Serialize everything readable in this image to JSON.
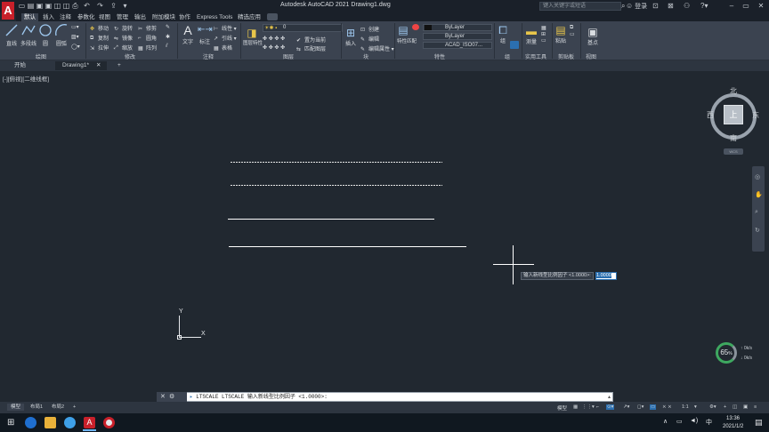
{
  "window": {
    "title": "Autodesk AutoCAD 2021    Drawing1.dwg",
    "search_placeholder": "键入关键字或短语",
    "user": "登录",
    "logo_letter": "A"
  },
  "menu_tabs": [
    "默认",
    "插入",
    "注释",
    "参数化",
    "视图",
    "管理",
    "输出",
    "附加模块",
    "协作",
    "Express Tools",
    "精选应用"
  ],
  "ribbon": {
    "draw": {
      "label": "绘图",
      "buttons": [
        "直线",
        "多段线",
        "圆",
        "圆弧"
      ]
    },
    "modify": {
      "label": "修改",
      "buttons": [
        "移动",
        "旋转",
        "修剪",
        "复制",
        "镜像",
        "圆角",
        "拉伸",
        "缩放",
        "阵列"
      ]
    },
    "annotation": {
      "label": "注释",
      "buttons": [
        "文字",
        "标注",
        "线性",
        "引线",
        "表格"
      ]
    },
    "layers": {
      "label": "图层",
      "current_layer": "0",
      "buttons": [
        "图层特性",
        "置为当前",
        "匹配图层"
      ]
    },
    "block": {
      "label": "块",
      "buttons": [
        "插入",
        "创建",
        "编辑",
        "编辑属性"
      ]
    },
    "properties": {
      "label": "特性",
      "buttons": [
        "特性匹配"
      ],
      "color": "ByLayer",
      "linetype": "ByLayer",
      "lineweight": "ACAD_ISO07..."
    },
    "groups": {
      "label": "组",
      "buttons": [
        "组"
      ]
    },
    "utilities": {
      "label": "实用工具",
      "buttons": [
        "测量"
      ]
    },
    "clipboard": {
      "label": "剪贴板",
      "buttons": [
        "粘贴"
      ]
    },
    "view": {
      "label": "视图",
      "buttons": [
        "基点"
      ]
    }
  },
  "doc_tabs": {
    "start": "开始",
    "drawing": "Drawing1*",
    "add": "+"
  },
  "viewport_label": "[-][俯视][二维线框]",
  "viewcube": {
    "top": "上",
    "north": "北",
    "south": "南",
    "east": "东",
    "west": "西",
    "wcs": "WCS"
  },
  "ucs": {
    "x": "X",
    "y": "Y"
  },
  "prompt": {
    "label": "输入新线型比例因子 <1.0000>:",
    "value": "1.0000"
  },
  "gauge": {
    "percent": "65",
    "unit": "%",
    "up": "0k/s",
    "down": "0k/s"
  },
  "command_line": "LTSCALE LTSCALE 输入新线型比例因子 <1.0000>:",
  "layout_tabs": [
    "模型",
    "布局1",
    "布局2",
    "+"
  ],
  "status": {
    "model": "模型",
    "scale": "1:1"
  },
  "taskbar": {
    "time": "13:36",
    "date": "2021/1/2"
  },
  "colors": {
    "canvas": "#212830",
    "ribbon": "#3b4350",
    "accent_red": "#c8202a",
    "selection_blue": "#2b6fb0"
  }
}
